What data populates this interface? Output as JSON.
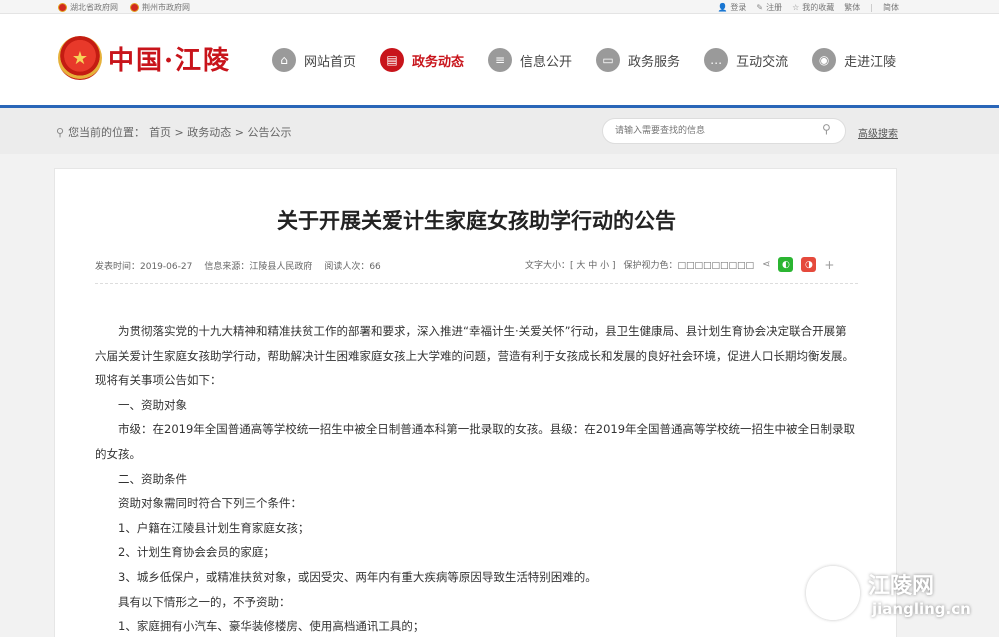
{
  "topbar": {
    "left": [
      "湖北省政府网",
      "荆州市政府网"
    ],
    "right": {
      "login": "登录",
      "register": "注册",
      "favorites": "我的收藏",
      "trad": "繁体",
      "simp": "简体"
    }
  },
  "header": {
    "logo_text": "中国·江陵",
    "nav": [
      "网站首页",
      "政务动态",
      "信息公开",
      "政务服务",
      "互动交流",
      "走进江陵"
    ],
    "active_index": 1
  },
  "breadcrumb": {
    "prefix": "您当前的位置：",
    "path": "首页 > 政务动态 > 公告公示"
  },
  "search": {
    "placeholder": "请输入需要查找的信息",
    "advanced": "高级搜索"
  },
  "article": {
    "title": "关于开展关爱计生家庭女孩助学行动的公告",
    "date": "发表时间：2019-06-27",
    "source": "信息来源：江陵县人民政府",
    "views": "阅读人次：66",
    "font_size": "文字大小：[ 大 中 小 ]",
    "eye_color": "保护视力色：□□□□□□□□□",
    "paragraphs": [
      "为贯彻落实党的十九大精神和精准扶贫工作的部署和要求，深入推进“幸福计生·关爱关怀”行动，县卫生健康局、县计划生育协会决定联合开展第六届关爱计生家庭女孩助学行动，帮助解决计生困难家庭女孩上大学难的问题，营造有利于女孩成长和发展的良好社会环境，促进人口长期均衡发展。现将有关事项公告如下：",
      "一、资助对象",
      "市级：在2019年全国普通高等学校统一招生中被全日制普通本科第一批录取的女孩。县级：在2019年全国普通高等学校统一招生中被全日制录取的女孩。",
      "二、资助条件",
      "资助对象需同时符合下列三个条件：",
      "1、户籍在江陵县计划生育家庭女孩；",
      "2、计划生育协会会员的家庭；",
      "3、城乡低保户，或精准扶贫对象，或因受灾、两年内有重大疾病等原因导致生活特别困难的。",
      "具有以下情形之一的，不予资助：",
      "1、家庭拥有小汽车、豪华装修楼房、使用高档通讯工具的；"
    ]
  },
  "watermark": {
    "name": "江陵网",
    "domain": "jiangling.cn"
  }
}
